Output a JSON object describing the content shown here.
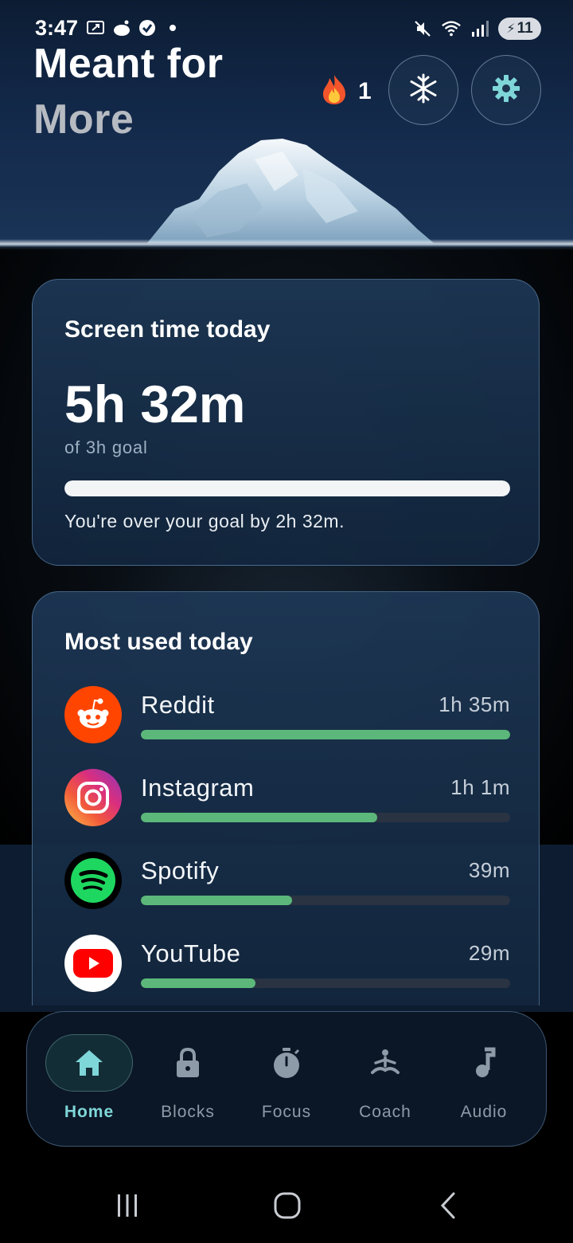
{
  "status_bar": {
    "time": "3:47",
    "battery": "11",
    "left_icons": [
      "screen-record-icon",
      "reddit-notification-icon",
      "blocked-icon",
      "dot-icon"
    ],
    "right_icons": [
      "mute-icon",
      "wifi-icon",
      "signal-icon",
      "battery-charging-icon"
    ]
  },
  "header": {
    "title_line1": "Meant for",
    "title_line2": "More",
    "streak_icon": "fire-icon",
    "streak_count": "1",
    "freeze_icon": "snowflake-icon",
    "settings_icon": "gear-icon"
  },
  "screen_time": {
    "title": "Screen time today",
    "value": "5h 32m",
    "goal_text": "of 3h goal",
    "progress_fraction": 1.0,
    "status_text": "You're over your goal by 2h 32m."
  },
  "most_used": {
    "title": "Most used today",
    "apps": [
      {
        "name": "Reddit",
        "time": "1h 35m",
        "fraction": 1.0,
        "icon": "reddit-icon"
      },
      {
        "name": "Instagram",
        "time": "1h 1m",
        "fraction": 0.64,
        "icon": "instagram-icon"
      },
      {
        "name": "Spotify",
        "time": "39m",
        "fraction": 0.41,
        "icon": "spotify-icon"
      },
      {
        "name": "YouTube",
        "time": "29m",
        "fraction": 0.31,
        "icon": "youtube-icon"
      }
    ]
  },
  "bottom_nav": {
    "items": [
      {
        "label": "Home",
        "icon": "home-icon",
        "active": true
      },
      {
        "label": "Blocks",
        "icon": "lock-icon",
        "active": false
      },
      {
        "label": "Focus",
        "icon": "stopwatch-icon",
        "active": false
      },
      {
        "label": "Coach",
        "icon": "meditation-icon",
        "active": false
      },
      {
        "label": "Audio",
        "icon": "music-note-icon",
        "active": false
      }
    ]
  },
  "system_nav": {
    "icons": [
      "recent-apps-icon",
      "home-circle-icon",
      "back-icon"
    ]
  },
  "colors": {
    "accent": "#7fd6d8",
    "progress_green": "#5cb87a",
    "card_bg": "#1e3856"
  }
}
